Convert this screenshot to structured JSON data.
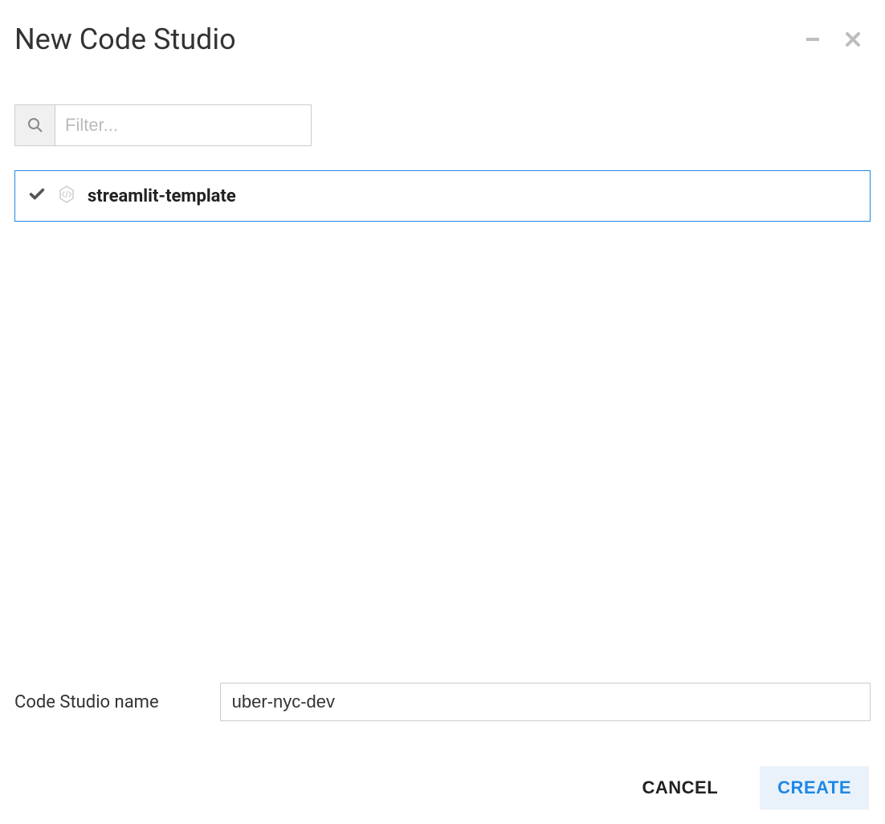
{
  "dialog": {
    "title": "New Code Studio"
  },
  "filter": {
    "placeholder": "Filter..."
  },
  "templates": [
    {
      "label": "streamlit-template",
      "selected": true
    }
  ],
  "form": {
    "name_label": "Code Studio name",
    "name_value": "uber-nyc-dev"
  },
  "actions": {
    "cancel_label": "CANCEL",
    "create_label": "CREATE"
  }
}
